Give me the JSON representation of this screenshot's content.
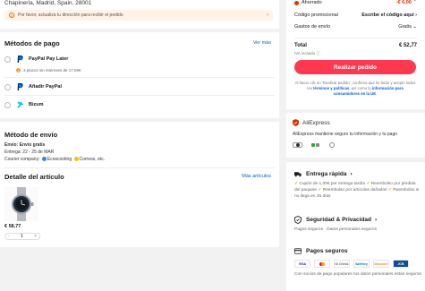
{
  "address": {
    "line": "Chapinería, Madrid, Spain, 28001"
  },
  "warning": {
    "text": "Por favor, actualiza tu dirección para recibir el pedido",
    "chevron": "›"
  },
  "payment": {
    "title": "Métodos de pago",
    "see_more": "Ver más",
    "methods": [
      {
        "label": "PayPal Pay Later",
        "note": "3 plazos sin intereses de 17,59€",
        "icon": "paypal-icon"
      },
      {
        "label": "Añadir PayPal",
        "icon": "paypal-icon"
      },
      {
        "label": "Bizum",
        "icon": "bizum-icon"
      }
    ]
  },
  "shipping": {
    "title": "Método de envío",
    "type": "Envío: Envío gratis",
    "delivery": "Entrega: 22 - 25 de MAR",
    "courier_prefix": "Courier company:",
    "courier_1": "Ecoscooting",
    "courier_2": "Correos",
    "courier_suffix": ", etc."
  },
  "items": {
    "title": "Detalle del artículo",
    "more": "Más artículos",
    "price": "€ 58,77",
    "qty": "1",
    "minus": "-",
    "plus": "+"
  },
  "summary": {
    "saved_label": "Ahorrado",
    "saved_value": "-€ 6,00",
    "promo_label": "Código promocional",
    "promo_value": "Escribe el código aquí",
    "ship_label": "Gastos de envío",
    "ship_value": "Gratis",
    "total_label": "Total",
    "total_value": "€ 52,77",
    "vat": "IVA incluido",
    "button": "Realizar pedido",
    "legal_1": "Al hacer clic en 'Realizar pedido', confirmo que he leído y acepto todos los",
    "legal_link_1": "términos y políticas",
    "legal_2": ", así como la",
    "legal_link_2": "información para consumidores en la UE",
    "legal_3": "."
  },
  "aliexpress": {
    "brand": "AliExpress",
    "desc": "AliExpress mantiene seguro tu información y tu pago"
  },
  "fast_delivery": {
    "title": "Entrega rápida",
    "chevron": "›",
    "bullets": [
      "Cupón de 1,00€ por entrega tardía",
      "Reembolso por pérdida del paquete",
      "Reembolso por artículos dañados",
      "Reembolso si no llega en 35 días"
    ]
  },
  "security": {
    "title": "Seguridad & Privacidad",
    "chevron": "›",
    "text": "Pagos seguros · Datos personales seguros"
  },
  "secure_payments": {
    "title": "Pagos seguros",
    "text": "Con socios de pago populares tus datos personales están seguros",
    "logos": [
      "VISA",
      "Mastercard",
      "ID Check",
      "SafeKey",
      "Discover",
      "JCB"
    ]
  },
  "colors": {
    "accent": "#fd384f",
    "link": "#0a5fc4",
    "saving": "#e62e04"
  }
}
